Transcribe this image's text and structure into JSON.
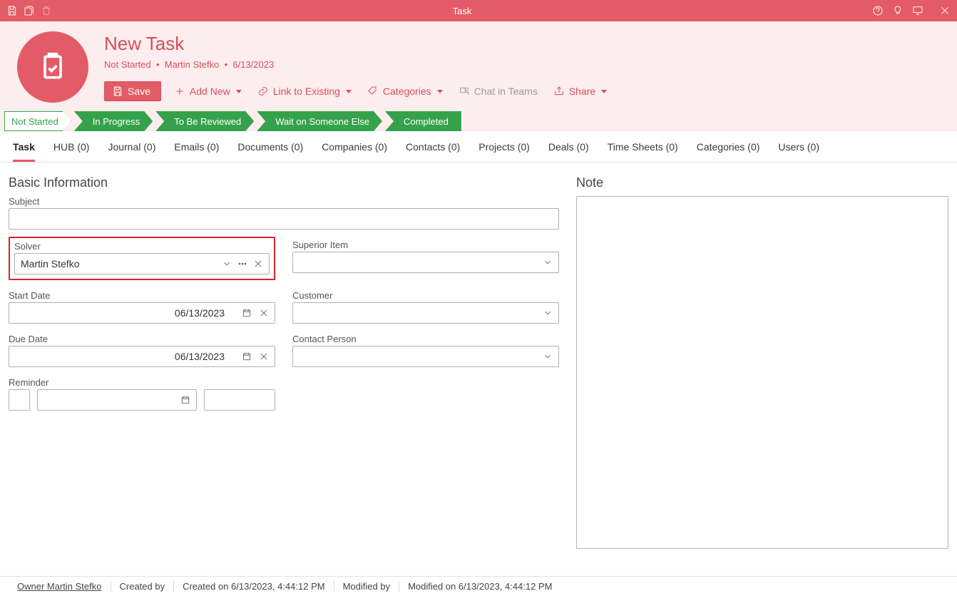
{
  "window": {
    "title": "Task"
  },
  "header": {
    "title": "New Task",
    "status": "Not Started",
    "owner": "Martin Stefko",
    "date": "6/13/2023"
  },
  "toolbar": {
    "save": "Save",
    "add_new": "Add New",
    "link_existing": "Link to Existing",
    "categories": "Categories",
    "chat_teams": "Chat in Teams",
    "share": "Share"
  },
  "steps": [
    "Not Started",
    "In Progress",
    "To Be Reviewed",
    "Wait on Someone Else",
    "Completed"
  ],
  "tabs": [
    "Task",
    "HUB (0)",
    "Journal (0)",
    "Emails (0)",
    "Documents (0)",
    "Companies (0)",
    "Contacts (0)",
    "Projects (0)",
    "Deals (0)",
    "Time Sheets (0)",
    "Categories (0)",
    "Users (0)"
  ],
  "section": {
    "basic": "Basic Information",
    "note": "Note"
  },
  "fields": {
    "subject_label": "Subject",
    "subject_value": "",
    "solver_label": "Solver",
    "solver_value": "Martin Stefko",
    "superior_label": "Superior Item",
    "superior_value": "",
    "start_label": "Start Date",
    "start_value": "06/13/2023",
    "customer_label": "Customer",
    "customer_value": "",
    "due_label": "Due Date",
    "due_value": "06/13/2023",
    "contact_label": "Contact Person",
    "contact_value": "",
    "reminder_label": "Reminder",
    "reminder_date": "",
    "reminder_time": ""
  },
  "status": {
    "owner": "Owner Martin Stefko",
    "created_by_lbl": "Created by",
    "created_on": "Created on 6/13/2023, 4:44:12 PM",
    "modified_by_lbl": "Modified by",
    "modified_on": "Modified on 6/13/2023, 4:44:12 PM"
  }
}
